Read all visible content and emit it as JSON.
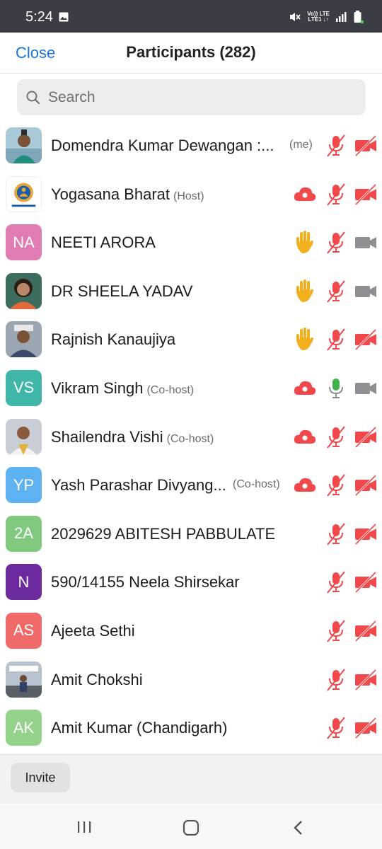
{
  "status_bar": {
    "time": "5:24",
    "network_top": "Vo)) LTE",
    "network_bottom": "LTE1 ↓↑"
  },
  "header": {
    "close_label": "Close",
    "title": "Participants (282)"
  },
  "search": {
    "placeholder": "Search"
  },
  "participants": [
    {
      "name": "Domendra Kumar Dewangan :...",
      "tag": "(me)",
      "initials": "",
      "avatar": "photo",
      "status": "",
      "mic": "muted",
      "video": "off"
    },
    {
      "name": "Yogasana Bharat",
      "tag": "(Host)",
      "initials": "",
      "avatar": "logo",
      "status": "cloud",
      "mic": "muted",
      "video": "off"
    },
    {
      "name": "NEETI ARORA",
      "tag": "",
      "initials": "NA",
      "avatar_color": "#e07cb1",
      "status": "hand",
      "mic": "muted",
      "video": "on"
    },
    {
      "name": "DR SHEELA YADAV",
      "tag": "",
      "initials": "",
      "avatar": "photo",
      "status": "hand",
      "mic": "muted",
      "video": "on"
    },
    {
      "name": "Rajnish Kanaujiya",
      "tag": "",
      "initials": "",
      "avatar": "photo",
      "status": "hand",
      "mic": "muted",
      "video": "off"
    },
    {
      "name": "Vikram Singh",
      "tag": "(Co-host)",
      "initials": "VS",
      "avatar_color": "#3fb6a8",
      "status": "cloud",
      "mic": "active",
      "video": "on"
    },
    {
      "name": "Shailendra Vishi",
      "tag": "(Co-host)",
      "initials": "",
      "avatar": "photo",
      "status": "cloud",
      "mic": "muted",
      "video": "off"
    },
    {
      "name": "Yash Parashar Divyang...",
      "tag": "(Co-host)",
      "initials": "YP",
      "avatar_color": "#5fb2f2",
      "status": "cloud",
      "mic": "muted",
      "video": "off"
    },
    {
      "name": "2029629 ABITESH PABBULATE",
      "tag": "",
      "initials": "2A",
      "avatar_color": "#80c97f",
      "status": "",
      "mic": "muted",
      "video": "off"
    },
    {
      "name": "590/14155 Neela Shirsekar",
      "tag": "",
      "initials": "N",
      "avatar_color": "#6d2a9e",
      "status": "",
      "mic": "muted",
      "video": "off"
    },
    {
      "name": "Ajeeta Sethi",
      "tag": "",
      "initials": "AS",
      "avatar_color": "#f16a6a",
      "status": "",
      "mic": "muted",
      "video": "off"
    },
    {
      "name": "Amit Chokshi",
      "tag": "",
      "initials": "",
      "avatar": "photo",
      "status": "",
      "mic": "muted",
      "video": "off"
    },
    {
      "name": "Amit Kumar (Chandigarh)",
      "tag": "",
      "initials": "AK",
      "avatar_color": "#95d28b",
      "status": "",
      "mic": "muted",
      "video": "off"
    }
  ],
  "footer": {
    "invite_label": "Invite"
  },
  "colors": {
    "accent": "#1a73d9",
    "muted_red": "#f0484b",
    "active_green": "#3fb24a",
    "hand": "#f2b01e",
    "video_gray": "#8e8e93"
  }
}
